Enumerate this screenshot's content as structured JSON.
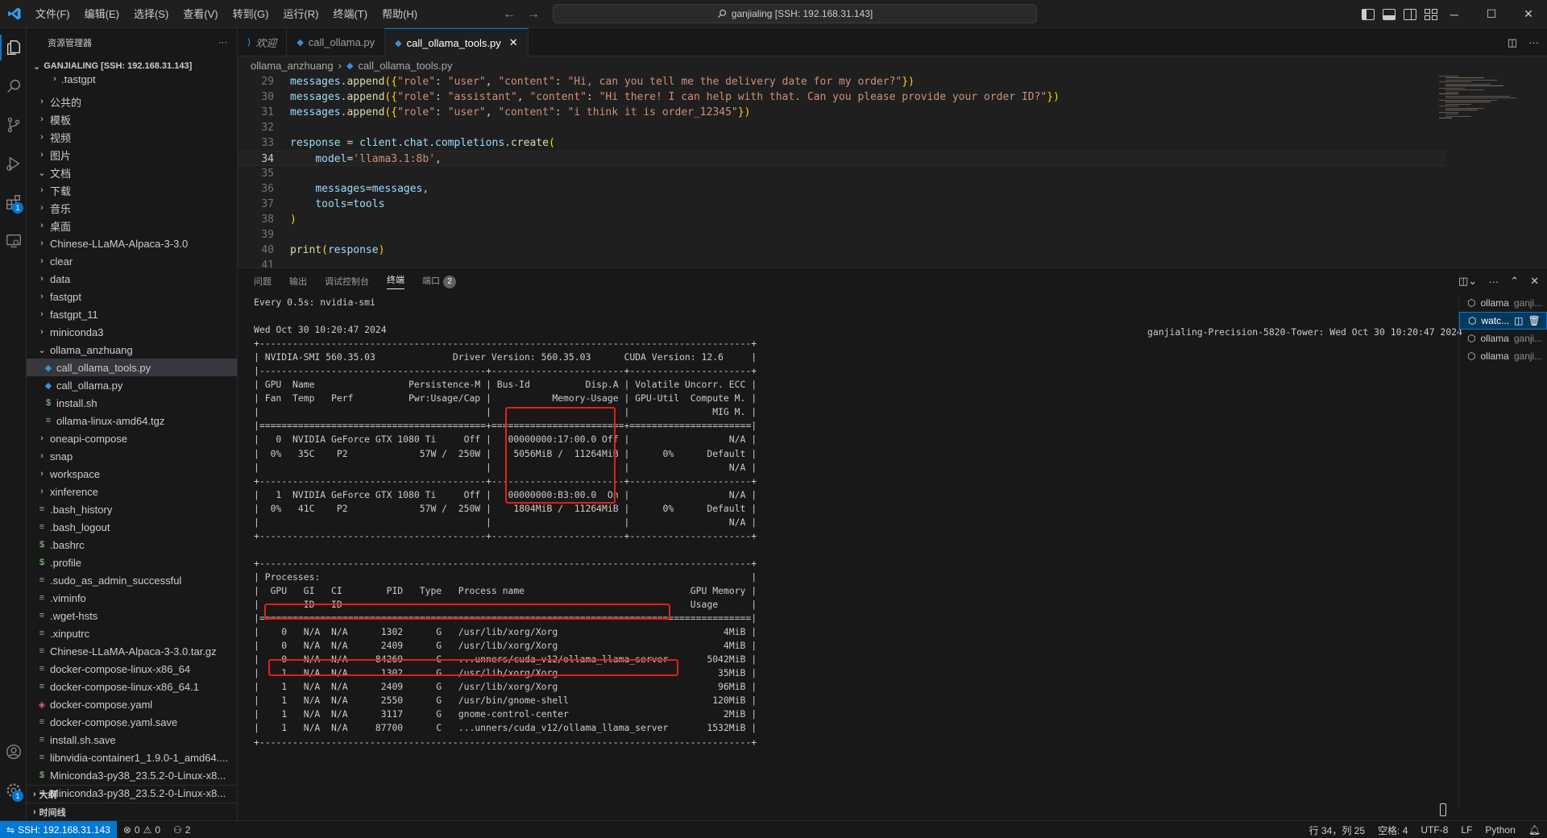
{
  "titlebar": {
    "menu": [
      "文件(F)",
      "编辑(E)",
      "选择(S)",
      "查看(V)",
      "转到(G)",
      "运行(R)",
      "终端(T)",
      "帮助(H)"
    ],
    "search_text": "ganjialing [SSH: 192.168.31.143]",
    "accent": "#0078d4"
  },
  "activity": {
    "items": [
      "explorer-icon",
      "search-icon",
      "source-control-icon",
      "run-debug-icon",
      "extensions-icon",
      "remote-explorer-icon"
    ],
    "extensions_badge": "1",
    "settings_badge": "1"
  },
  "sidebar": {
    "title": "资源管理器",
    "more": "···",
    "root": "GANJIALING [SSH: 192.168.31.143]",
    "partial_top": ".fastgpt",
    "tree": [
      {
        "label": "公共的",
        "kind": "folder",
        "chev": "›",
        "indent": 1
      },
      {
        "label": "模板",
        "kind": "folder",
        "chev": "›",
        "indent": 1
      },
      {
        "label": "视频",
        "kind": "folder",
        "chev": "›",
        "indent": 1
      },
      {
        "label": "图片",
        "kind": "folder",
        "chev": "›",
        "indent": 1
      },
      {
        "label": "文档",
        "kind": "folder",
        "chev": "⌄",
        "indent": 1
      },
      {
        "label": "下载",
        "kind": "folder",
        "chev": "›",
        "indent": 1
      },
      {
        "label": "音乐",
        "kind": "folder",
        "chev": "›",
        "indent": 1
      },
      {
        "label": "桌面",
        "kind": "folder",
        "chev": "›",
        "indent": 1
      },
      {
        "label": "Chinese-LLaMA-Alpaca-3-3.0",
        "kind": "folder",
        "chev": "›",
        "indent": 1
      },
      {
        "label": "clear",
        "kind": "folder",
        "chev": "›",
        "indent": 1
      },
      {
        "label": "data",
        "kind": "folder",
        "chev": "›",
        "indent": 1
      },
      {
        "label": "fastgpt",
        "kind": "folder",
        "chev": "›",
        "indent": 1
      },
      {
        "label": "fastgpt_11",
        "kind": "folder",
        "chev": "›",
        "indent": 1
      },
      {
        "label": "miniconda3",
        "kind": "folder",
        "chev": "›",
        "indent": 1
      },
      {
        "label": "ollama_anzhuang",
        "kind": "folder",
        "chev": "⌄",
        "indent": 1
      },
      {
        "label": "call_ollama_tools.py",
        "kind": "py",
        "chev": "",
        "indent": 2,
        "selected": true
      },
      {
        "label": "call_ollama.py",
        "kind": "py",
        "chev": "",
        "indent": 2
      },
      {
        "label": "install.sh",
        "kind": "sh",
        "chev": "",
        "indent": 2
      },
      {
        "label": "ollama-linux-amd64.tgz",
        "kind": "file",
        "chev": "",
        "indent": 2
      },
      {
        "label": "oneapi-compose",
        "kind": "folder",
        "chev": "›",
        "indent": 1
      },
      {
        "label": "snap",
        "kind": "folder",
        "chev": "›",
        "indent": 1
      },
      {
        "label": "workspace",
        "kind": "folder",
        "chev": "›",
        "indent": 1
      },
      {
        "label": "xinference",
        "kind": "folder",
        "chev": "›",
        "indent": 1
      },
      {
        "label": ".bash_history",
        "kind": "file",
        "chev": "",
        "indent": 1
      },
      {
        "label": ".bash_logout",
        "kind": "file",
        "chev": "",
        "indent": 1
      },
      {
        "label": ".bashrc",
        "kind": "sh",
        "chev": "",
        "indent": 1
      },
      {
        "label": ".profile",
        "kind": "sh",
        "chev": "",
        "indent": 1
      },
      {
        "label": ".sudo_as_admin_successful",
        "kind": "file",
        "chev": "",
        "indent": 1
      },
      {
        "label": ".viminfo",
        "kind": "file",
        "chev": "",
        "indent": 1
      },
      {
        "label": ".wget-hsts",
        "kind": "file",
        "chev": "",
        "indent": 1
      },
      {
        "label": ".xinputrc",
        "kind": "file",
        "chev": "",
        "indent": 1
      },
      {
        "label": "Chinese-LLaMA-Alpaca-3-3.0.tar.gz",
        "kind": "file",
        "chev": "",
        "indent": 1
      },
      {
        "label": "docker-compose-linux-x86_64",
        "kind": "file",
        "chev": "",
        "indent": 1
      },
      {
        "label": "docker-compose-linux-x86_64.1",
        "kind": "file",
        "chev": "",
        "indent": 1
      },
      {
        "label": "docker-compose.yaml",
        "kind": "docker",
        "chev": "",
        "indent": 1
      },
      {
        "label": "docker-compose.yaml.save",
        "kind": "file",
        "chev": "",
        "indent": 1
      },
      {
        "label": "install.sh.save",
        "kind": "file",
        "chev": "",
        "indent": 1
      },
      {
        "label": "libnvidia-container1_1.9.0-1_amd64....",
        "kind": "file",
        "chev": "",
        "indent": 1
      },
      {
        "label": "Miniconda3-py38_23.5.2-0-Linux-x8...",
        "kind": "sh",
        "chev": "",
        "indent": 1
      },
      {
        "label": "Miniconda3-py38_23.5.2-0-Linux-x8...",
        "kind": "file",
        "chev": "",
        "indent": 1
      }
    ],
    "sections": [
      "大纲",
      "时间线"
    ]
  },
  "editor": {
    "tabs": [
      {
        "label": "欢迎",
        "icon": "vscode-logo-icon",
        "italic": true,
        "active": false
      },
      {
        "label": "call_ollama.py",
        "icon": "python-icon",
        "active": false
      },
      {
        "label": "call_ollama_tools.py",
        "icon": "python-icon",
        "active": true
      }
    ],
    "breadcrumb": [
      "ollama_anzhuang",
      "call_ollama_tools.py"
    ],
    "lines": [
      {
        "n": "29",
        "code": "messages.append({\"role\": \"user\", \"content\": \"Hi, can you tell me the delivery date for my order?\"})"
      },
      {
        "n": "30",
        "code": "messages.append({\"role\": \"assistant\", \"content\": \"Hi there! I can help with that. Can you please provide your order ID?\"})"
      },
      {
        "n": "31",
        "code": "messages.append({\"role\": \"user\", \"content\": \"i think it is order_12345\"})"
      },
      {
        "n": "32",
        "code": ""
      },
      {
        "n": "33",
        "code": "response = client.chat.completions.create("
      },
      {
        "n": "34",
        "code": "    model='llama3.1:8b',",
        "current": true
      },
      {
        "n": "35",
        "code": ""
      },
      {
        "n": "36",
        "code": "    messages=messages,"
      },
      {
        "n": "37",
        "code": "    tools=tools"
      },
      {
        "n": "38",
        "code": ")"
      },
      {
        "n": "39",
        "code": ""
      },
      {
        "n": "40",
        "code": "print(response)"
      },
      {
        "n": "41",
        "code": ""
      }
    ]
  },
  "panel": {
    "tabs": [
      "问题",
      "输出",
      "调试控制台",
      "终端",
      "端口"
    ],
    "active_tab": "终端",
    "ports_count": "2",
    "terminal_right_header": "ganjialing-Precision-5820-Tower: Wed Oct 30 10:20:47 2024",
    "terminal_lines": [
      "Every 0.5s: nvidia-smi",
      "",
      "Wed Oct 30 10:20:47 2024",
      "+-----------------------------------------------------------------------------------------+",
      "| NVIDIA-SMI 560.35.03              Driver Version: 560.35.03      CUDA Version: 12.6     |",
      "|-----------------------------------------+------------------------+----------------------+",
      "| GPU  Name                 Persistence-M | Bus-Id          Disp.A | Volatile Uncorr. ECC |",
      "| Fan  Temp   Perf          Pwr:Usage/Cap |           Memory-Usage | GPU-Util  Compute M. |",
      "|                                         |                        |               MIG M. |",
      "|=========================================+========================+======================|",
      "|   0  NVIDIA GeForce GTX 1080 Ti     Off |   00000000:17:00.0 Off |                  N/A |",
      "|  0%   35C    P2             57W /  250W |    5056MiB /  11264MiB |      0%      Default |",
      "|                                         |                        |                  N/A |",
      "+-----------------------------------------+------------------------+----------------------+",
      "|   1  NVIDIA GeForce GTX 1080 Ti     Off |   00000000:B3:00.0  On |                  N/A |",
      "|  0%   41C    P2             57W /  250W |    1804MiB /  11264MiB |      0%      Default |",
      "|                                         |                        |                  N/A |",
      "+-----------------------------------------+------------------------+----------------------+",
      "",
      "+-----------------------------------------------------------------------------------------+",
      "| Processes:                                                                              |",
      "|  GPU   GI   CI        PID   Type   Process name                              GPU Memory |",
      "|        ID   ID                                                               Usage      |",
      "|=========================================================================================|",
      "|    0   N/A  N/A      1302      G   /usr/lib/xorg/Xorg                              4MiB |",
      "|    0   N/A  N/A      2409      G   /usr/lib/xorg/Xorg                              4MiB |",
      "|    0   N/A  N/A     84269      C   ...unners/cuda_v12/ollama_llama_server       5042MiB |",
      "|    1   N/A  N/A      1302      G   /usr/lib/xorg/Xorg                             35MiB |",
      "|    1   N/A  N/A      2409      G   /usr/lib/xorg/Xorg                             96MiB |",
      "|    1   N/A  N/A      2550      G   /usr/bin/gnome-shell                          120MiB |",
      "|    1   N/A  N/A      3117      G   gnome-control-center                            2MiB |",
      "|    1   N/A  N/A     87700      C   ...unners/cuda_v12/ollama_llama_server       1532MiB |",
      "+-----------------------------------------------------------------------------------------+"
    ],
    "terminal_instances": [
      {
        "name": "ollama",
        "sub": "ganji..."
      },
      {
        "name": "watc...",
        "sub": "",
        "active": true
      },
      {
        "name": "ollama",
        "sub": "ganji..."
      },
      {
        "name": "ollama",
        "sub": "ganji..."
      }
    ],
    "highlight_color": "#e0201c"
  },
  "statusbar": {
    "remote": "SSH: 192.168.31.143",
    "errors": "0",
    "warnings": "0",
    "ports": "2",
    "position": "行 34，列 25",
    "spaces": "空格: 4",
    "encoding": "UTF-8",
    "eol": "LF",
    "language": "Python"
  }
}
